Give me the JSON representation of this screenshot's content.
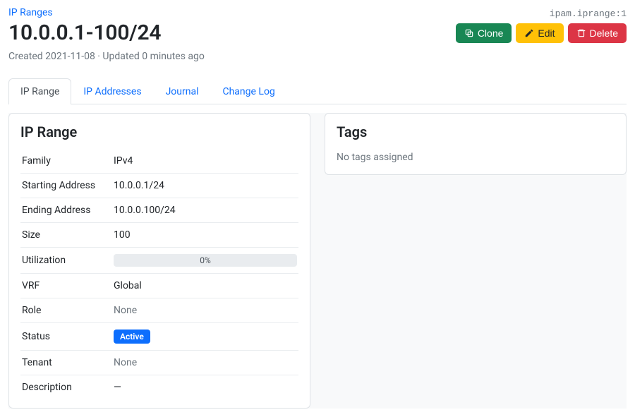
{
  "breadcrumb": {
    "parent": "IP Ranges"
  },
  "object_id": "ipam.iprange:1",
  "title": "10.0.0.1-100/24",
  "meta": "Created 2021-11-08 · Updated 0 minutes ago",
  "buttons": {
    "clone": "Clone",
    "edit": "Edit",
    "delete": "Delete"
  },
  "tabs": [
    "IP Range",
    "IP Addresses",
    "Journal",
    "Change Log"
  ],
  "active_tab_index": 0,
  "panel_left": {
    "heading": "IP Range",
    "rows": {
      "family": {
        "label": "Family",
        "value": "IPv4"
      },
      "start": {
        "label": "Starting Address",
        "value": "10.0.0.1/24"
      },
      "end": {
        "label": "Ending Address",
        "value": "10.0.0.100/24"
      },
      "size": {
        "label": "Size",
        "value": "100"
      },
      "util": {
        "label": "Utilization",
        "value": "0%"
      },
      "vrf": {
        "label": "VRF",
        "value": "Global"
      },
      "role": {
        "label": "Role",
        "value": "None"
      },
      "status": {
        "label": "Status",
        "value": "Active"
      },
      "tenant": {
        "label": "Tenant",
        "value": "None"
      },
      "description": {
        "label": "Description",
        "value": "—"
      }
    }
  },
  "panel_right": {
    "heading": "Tags",
    "empty_text": "No tags assigned"
  },
  "colors": {
    "link": "#0d6efd",
    "success": "#198754",
    "warning": "#ffc107",
    "danger": "#dc3545",
    "badge": "#0d6efd"
  }
}
